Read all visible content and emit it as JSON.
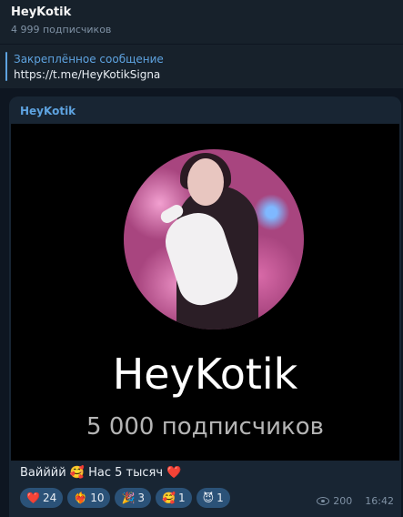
{
  "header": {
    "title": "HeyKotik",
    "subscribers": "4 999 подписчиков"
  },
  "pinned": {
    "title": "Закреплённое сообщение",
    "text": "https://t.me/HeyKotikSigna"
  },
  "message": {
    "sender": "HeyKotik",
    "image": {
      "name": "HeyKotik",
      "subscribers": "5 000 подписчиков"
    },
    "caption": "Вайййй 🥰 Нас 5 тысяч ❤️",
    "reactions": [
      {
        "emoji": "❤️",
        "count": "24"
      },
      {
        "emoji": "❤️‍🔥",
        "count": "10"
      },
      {
        "emoji": "🎉",
        "count": "3"
      },
      {
        "emoji": "🥰",
        "count": "1"
      },
      {
        "emoji": "😈",
        "count": "1"
      }
    ],
    "views": "200",
    "time": "16:42"
  },
  "colors": {
    "background": "#0e1621",
    "panel": "#17212b",
    "bubble": "#182533",
    "accent": "#5ea3e0",
    "reaction_bg": "#2b5278",
    "muted": "#7f91a4"
  },
  "icons": [
    "eye-icon"
  ]
}
